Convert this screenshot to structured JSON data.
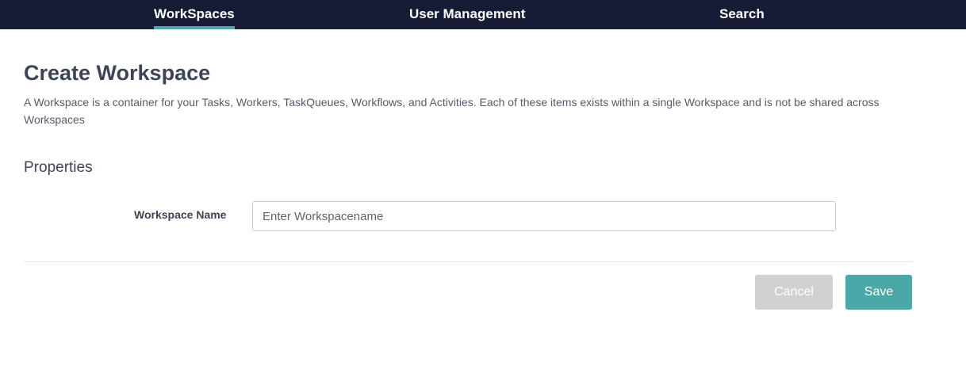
{
  "nav": {
    "tabs": [
      {
        "label": "WorkSpaces",
        "active": true
      },
      {
        "label": "User Management",
        "active": false
      },
      {
        "label": "Search",
        "active": false
      }
    ]
  },
  "page": {
    "title": "Create Workspace",
    "description": "A Workspace is a container for your Tasks, Workers, TaskQueues, Workflows, and Activities. Each of these items exists within a single Workspace and is not be shared across Workspaces"
  },
  "properties": {
    "heading": "Properties",
    "workspace_name": {
      "label": "Workspace Name",
      "value": "",
      "placeholder": "Enter Workspacename"
    }
  },
  "actions": {
    "cancel_label": "Cancel",
    "save_label": "Save"
  },
  "colors": {
    "nav_background": "#161c35",
    "accent": "#4aa9a8",
    "cancel_button": "#d1d1d1"
  }
}
